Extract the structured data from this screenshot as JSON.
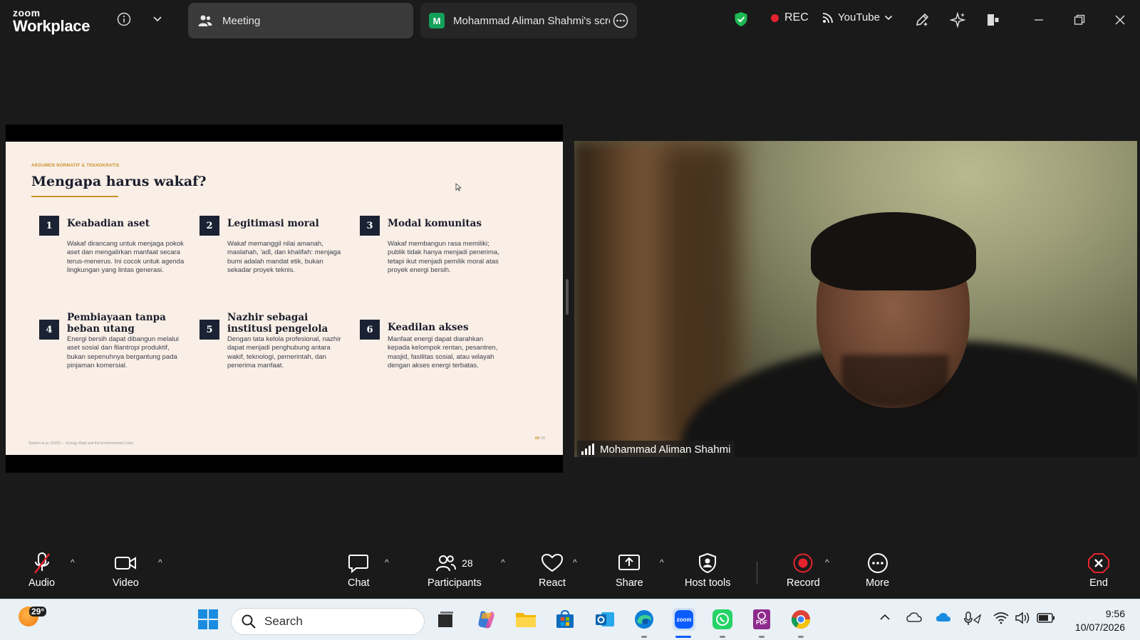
{
  "app": {
    "brand_top": "zoom",
    "brand_bottom": "Workplace"
  },
  "tabs": [
    {
      "label": "Meeting"
    },
    {
      "badge": "M",
      "label": "Mohammad Aliman Shahmi's scre"
    }
  ],
  "status": {
    "rec_label": "REC",
    "stream_label": "YouTube"
  },
  "slide": {
    "kicker": "ARGUMEN NORMATIF & TEKNOKRATIS",
    "title": "Mengapa harus wakaf?",
    "cards": [
      {
        "num": "1",
        "title": "Keabadian aset",
        "text": "Wakaf dirancang untuk menjaga pokok aset dan mengalirkan manfaat secara terus-menerus. Ini cocok untuk agenda lingkungan yang lintas generasi."
      },
      {
        "num": "2",
        "title": "Legitimasi moral",
        "text": "Wakaf memanggil nilai amanah, maslahah, 'adl, dan khalifah: menjaga bumi adalah mandat etik, bukan sekadar proyek teknis."
      },
      {
        "num": "3",
        "title": "Modal komunitas",
        "text": "Wakaf membangun rasa memiliki; publik tidak hanya menjadi penerima, tetapi ikut menjadi pemilik moral atas proyek energi bersih."
      },
      {
        "num": "4",
        "title": "Pembiayaan tanpa beban utang",
        "text": "Energi bersih dapat dibangun melalui aset sosial dan filantropi produktif, bukan sepenuhnya bergantung pada pinjaman komersial."
      },
      {
        "num": "5",
        "title": "Nazhir sebagai institusi pengelola",
        "text": "Dengan tata kelola profesional, nazhir dapat menjadi penghubung antara wakif, teknologi, pemerintah, dan penerima manfaat."
      },
      {
        "num": "6",
        "title": "Keadilan akses",
        "text": "Manfaat energi dapat diarahkan kepada kelompok rentan, pesantren, masjid, fasilitas sosial, atau wilayah dengan akses energi terbatas."
      }
    ],
    "footer_left": "Shahmi et al. (2026) — Energy Waqf and the Environmental Crisis",
    "footer_page": "06",
    "footer_total": "/ 18"
  },
  "video": {
    "participant_name": "Mohammad Aliman Shahmi"
  },
  "toolbar": {
    "audio": "Audio",
    "video": "Video",
    "chat": "Chat",
    "participants": "Participants",
    "participants_count": "28",
    "react": "React",
    "share": "Share",
    "host_tools": "Host tools",
    "record": "Record",
    "more": "More",
    "end": "End"
  },
  "taskbar": {
    "temperature": "29°",
    "search_placeholder": "Search",
    "time": "9:56",
    "date": "10/07/2026"
  },
  "colors": {
    "accent_green": "#14a05a",
    "record_red": "#e5232f",
    "slide_bg": "#f9efe6",
    "slide_accent": "#c8912a",
    "slide_navy": "#1b2233"
  }
}
